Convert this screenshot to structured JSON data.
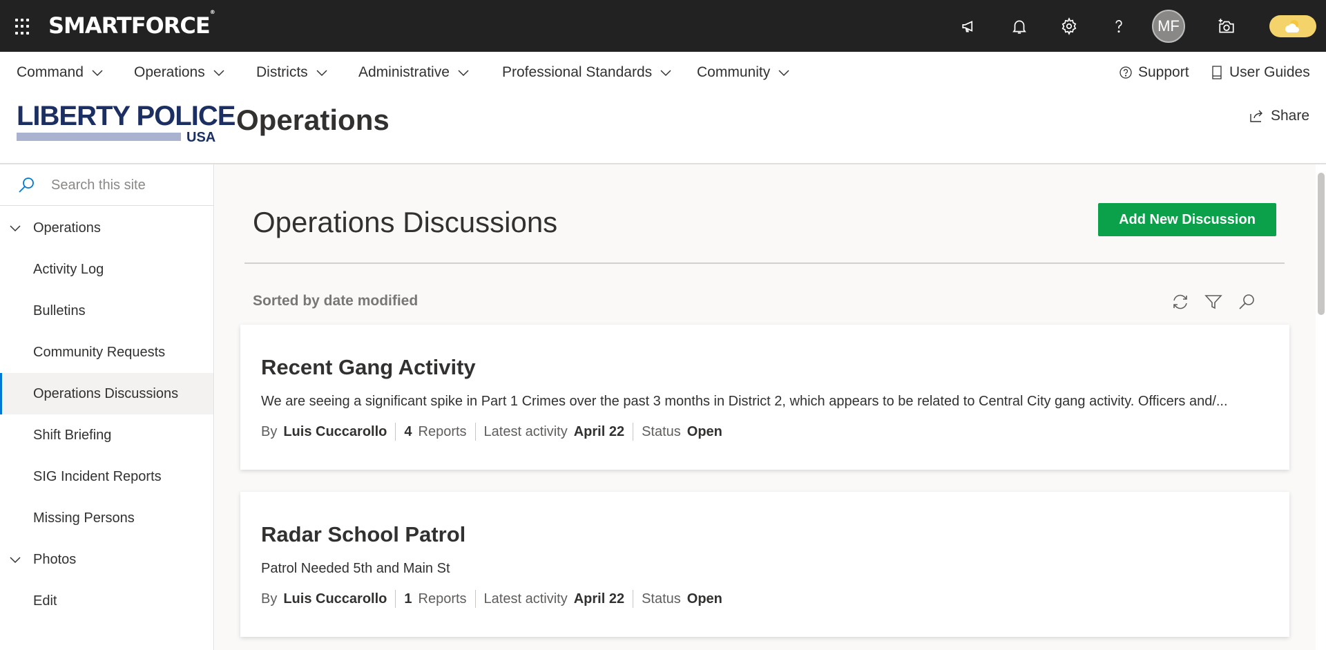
{
  "suite": {
    "brand": "SMARTFORCE",
    "brand_mark": "®",
    "avatar_initials": "MF"
  },
  "hubnav": {
    "items": [
      {
        "label": "Command"
      },
      {
        "label": "Operations"
      },
      {
        "label": "Districts"
      },
      {
        "label": "Administrative"
      },
      {
        "label": "Professional Standards"
      },
      {
        "label": "Community"
      }
    ],
    "support": "Support",
    "user_guides": "User Guides"
  },
  "site": {
    "logo_top": "LIBERTY POLICE",
    "logo_bottom": "USA",
    "title": "Operations",
    "share": "Share"
  },
  "leftnav": {
    "search_placeholder": "Search this site",
    "items": [
      {
        "label": "Operations"
      },
      {
        "label": "Activity Log"
      },
      {
        "label": "Bulletins"
      },
      {
        "label": "Community Requests"
      },
      {
        "label": "Operations Discussions"
      },
      {
        "label": "Shift Briefing"
      },
      {
        "label": "SIG Incident Reports"
      },
      {
        "label": "Missing Persons"
      },
      {
        "label": "Photos"
      },
      {
        "label": "Edit"
      }
    ]
  },
  "main": {
    "title": "Operations Discussions",
    "add_button": "Add New Discussion",
    "sorted_label": "Sorted by date modified",
    "meta_labels": {
      "by": "By",
      "reports": "Reports",
      "latest_activity": "Latest activity",
      "status": "Status"
    },
    "discussions": [
      {
        "title": "Recent Gang Activity",
        "body": "We are seeing a significant spike in Part 1 Crimes over the past 3 months in District 2, which appears to be related to Central City gang activity. Officers and/...",
        "author": "Luis Cuccarollo",
        "reports": "4",
        "latest": "April 22",
        "status": "Open"
      },
      {
        "title": "Radar School Patrol",
        "body": "Patrol Needed 5th and Main St",
        "author": "Luis Cuccarollo",
        "reports": "1",
        "latest": "April 22",
        "status": "Open"
      }
    ]
  }
}
